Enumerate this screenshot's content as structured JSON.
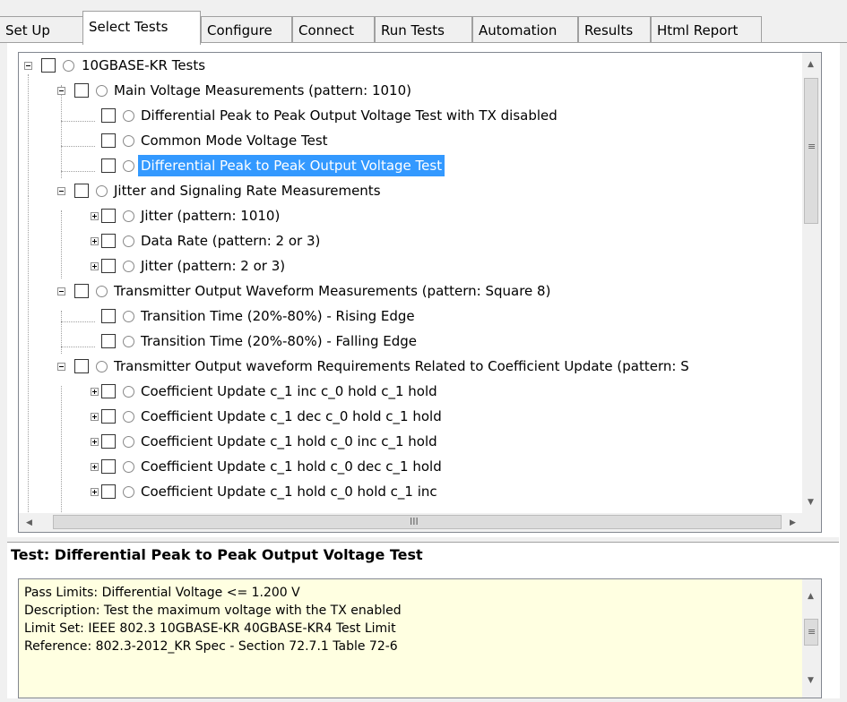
{
  "tabs": [
    {
      "label": "Set Up"
    },
    {
      "label": "Select Tests"
    },
    {
      "label": "Configure"
    },
    {
      "label": "Connect"
    },
    {
      "label": "Run Tests"
    },
    {
      "label": "Automation"
    },
    {
      "label": "Results"
    },
    {
      "label": "Html Report"
    }
  ],
  "active_tab": "Select Tests",
  "tree": {
    "root": "10GBASE-KR Tests",
    "groups": [
      {
        "label": "Main Voltage Measurements (pattern: 1010)",
        "items": [
          "Differential Peak to Peak Output Voltage Test with TX disabled",
          "Common Mode Voltage Test",
          "Differential Peak to Peak Output Voltage Test"
        ]
      },
      {
        "label": "Jitter and Signaling Rate Measurements",
        "items": [
          "Jitter (pattern: 1010)",
          "Data Rate (pattern: 2 or 3)",
          "Jitter (pattern: 2 or 3)"
        ]
      },
      {
        "label": "Transmitter Output Waveform Measurements (pattern: Square 8)",
        "items": [
          "Transition Time (20%-80%) - Rising Edge",
          "Transition Time (20%-80%) - Falling Edge"
        ]
      },
      {
        "label": "Transmitter Output waveform Requirements Related to Coefficient Update (pattern: S",
        "items": [
          "Coefficient Update c_1 inc c_0 hold c_1 hold",
          "Coefficient Update c_1 dec c_0 hold c_1 hold",
          "Coefficient Update c_1 hold c_0 inc c_1 hold",
          "Coefficient Update c_1 hold c_0 dec c_1 hold",
          "Coefficient Update c_1 hold c_0 hold c_1 inc"
        ]
      }
    ],
    "selected_item": "Differential Peak to Peak Output Voltage Test",
    "scrollbar_grip": "III"
  },
  "details": {
    "title": "Test: Differential Peak to Peak Output Voltage Test",
    "pass_limits": "Pass Limits: Differential Voltage <= 1.200 V",
    "description": "Description: Test the maximum voltage with the TX enabled",
    "limit_set": "Limit Set: IEEE 802.3 10GBASE-KR 40GBASE-KR4 Test Limit",
    "reference": "Reference: 802.3-2012_KR Spec - Section 72.7.1 Table 72-6"
  },
  "colors": {
    "selection": "#3399ff",
    "details_background": "#ffffe1",
    "window_background": "#f0f0f0"
  },
  "icons": [
    "collapse-icon",
    "expand-icon",
    "checkbox-icon",
    "radio-icon",
    "arrow-up-icon",
    "arrow-down-icon",
    "arrow-left-icon",
    "arrow-right-icon"
  ]
}
